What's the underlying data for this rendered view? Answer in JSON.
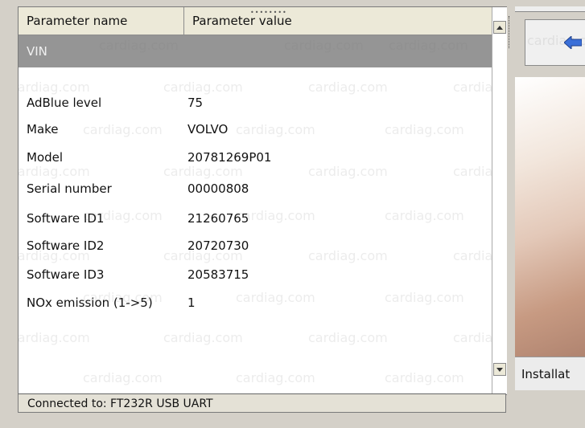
{
  "table": {
    "col_name_label": "Parameter name",
    "col_value_label": "Parameter value",
    "section_label": "VIN",
    "rows": [
      {
        "name": "AdBlue level",
        "value": "75"
      },
      {
        "name": "Make",
        "value": "VOLVO"
      },
      {
        "name": "Model",
        "value": "20781269P01"
      },
      {
        "name": "Serial number",
        "value": "00000808"
      },
      {
        "name": "Software ID1",
        "value": "21260765"
      },
      {
        "name": "Software ID2",
        "value": "20720730"
      },
      {
        "name": "Software ID3",
        "value": "20583715"
      },
      {
        "name": "NOx emission (1->5)",
        "value": "1"
      }
    ]
  },
  "status_bar": {
    "text": "Connected to: FT232R USB UART"
  },
  "right_panel": {
    "installation_label": "Installat"
  },
  "icons": {
    "back_button": "arrow-left-icon"
  },
  "watermark_text": "cardiag.com",
  "colors": {
    "section_row_bg": "#959595",
    "header_bg": "#ece9d8",
    "arrow_blue": "#3a6fd8"
  }
}
